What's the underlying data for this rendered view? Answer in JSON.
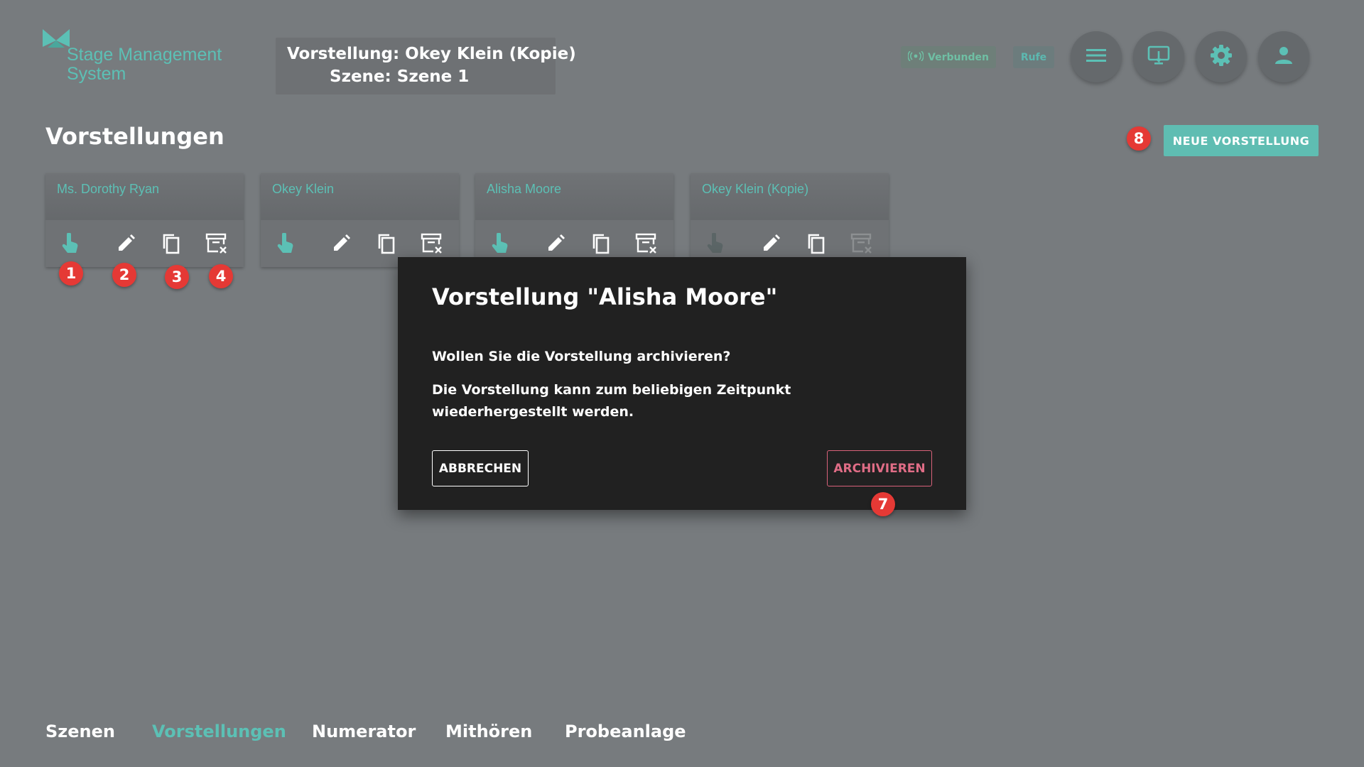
{
  "app": {
    "logo_line1": "Stage Management",
    "logo_line2": "System",
    "accent": "#5cc0b5"
  },
  "header": {
    "performance_label": "Vorstellung:",
    "performance_value": "Okey Klein (Kopie)",
    "scene_label": "Szene:",
    "scene_value": "Szene 1",
    "status_connected": "Verbunden",
    "calls_label": "Rufe",
    "icons": [
      "menu-icon",
      "screen-touch-icon",
      "gear-icon",
      "user-icon"
    ]
  },
  "page": {
    "title": "Vorstellungen",
    "new_button": "NEUE VORSTELLUNG"
  },
  "cards": [
    {
      "title": "Ms. Dorothy Ryan"
    },
    {
      "title": "Okey Klein"
    },
    {
      "title": "Alisha Moore"
    },
    {
      "title": "Okey Klein (Kopie)"
    }
  ],
  "card_actions": [
    "select-icon",
    "edit-icon",
    "copy-icon",
    "archive-icon"
  ],
  "markers": [
    "1",
    "2",
    "3",
    "4",
    "7",
    "8"
  ],
  "dialog": {
    "title": "Vorstellung \"Alisha Moore\"",
    "question": "Wollen Sie die Vorstellung archivieren?",
    "description": "Die Vorstellung kann zum beliebigen Zeitpunkt wiederhergestellt werden.",
    "cancel": "ABBRECHEN",
    "archive": "ARCHIVIEREN"
  },
  "nav": {
    "tabs": [
      "Szenen",
      "Vorstellungen",
      "Numerator",
      "Mithören",
      "Probeanlage"
    ],
    "active": "Vorstellungen"
  }
}
